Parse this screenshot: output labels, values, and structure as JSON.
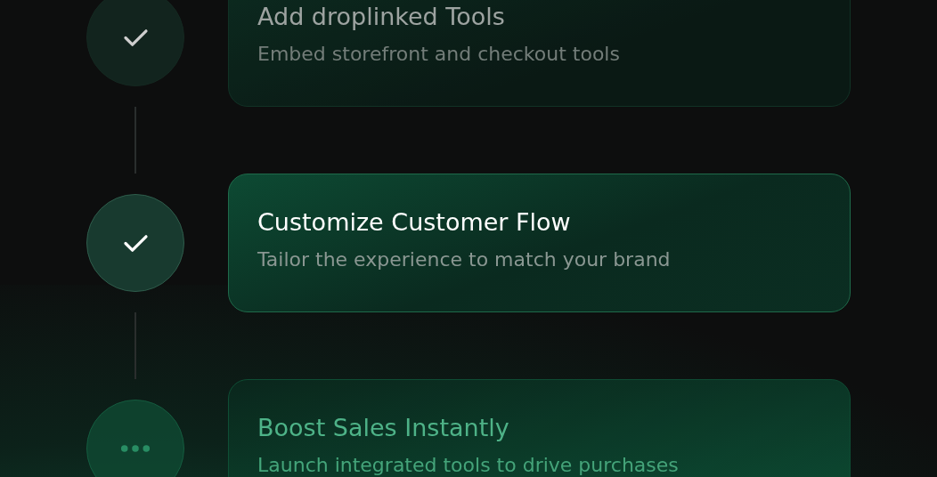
{
  "steps": [
    {
      "title": "Add droplinked Tools",
      "description": "Embed storefront and checkout tools",
      "kind": "done",
      "focused": false
    },
    {
      "title": "Customize Customer Flow",
      "description": "Tailor the experience to match your brand",
      "kind": "done",
      "focused": true
    },
    {
      "title": "Boost Sales Instantly",
      "description": "Launch integrated tools to drive purchases",
      "kind": "pending",
      "focused": false
    }
  ]
}
